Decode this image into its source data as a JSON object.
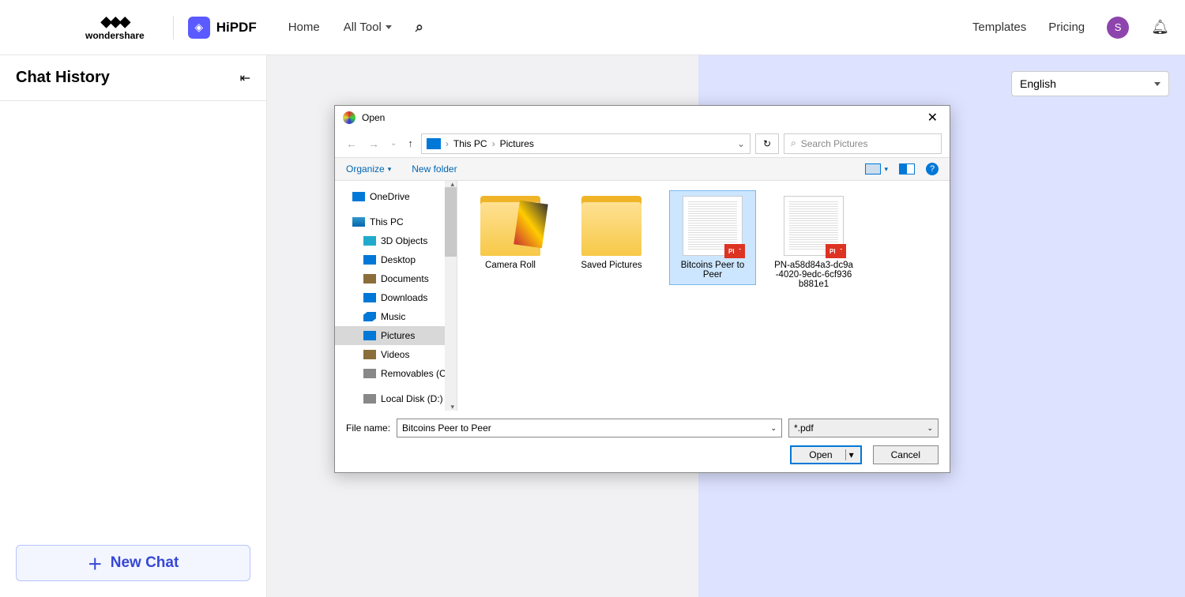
{
  "header": {
    "wondershare": "wondershare",
    "hipdf": "HiPDF",
    "home": "Home",
    "all_tool": "All Tool",
    "templates": "Templates",
    "pricing": "Pricing",
    "avatar_initial": "S"
  },
  "sidebar": {
    "title": "Chat History",
    "new_chat": "New Chat"
  },
  "main": {
    "language": "English"
  },
  "dialog": {
    "title": "Open",
    "breadcrumb": {
      "root": "This PC",
      "folder": "Pictures"
    },
    "search_placeholder": "Search Pictures",
    "organize": "Organize",
    "new_folder": "New folder",
    "tree": {
      "onedrive": "OneDrive",
      "this_pc": "This PC",
      "objects3d": "3D Objects",
      "desktop": "Desktop",
      "documents": "Documents",
      "downloads": "Downloads",
      "music": "Music",
      "pictures": "Pictures",
      "videos": "Videos",
      "removables": "Removables (C:)",
      "local_d": "Local Disk (D:)"
    },
    "files": {
      "camera_roll": "Camera Roll",
      "saved_pictures": "Saved Pictures",
      "bitcoins": "Bitcoins Peer to Peer",
      "pn_file": "PN-a58d84a3-dc9a-4020-9edc-6cf936b881e1",
      "pdf_badge": "PDF"
    },
    "filename_label": "File name:",
    "filename_value": "Bitcoins Peer to Peer",
    "filetype": "*.pdf",
    "open_btn": "Open",
    "cancel_btn": "Cancel"
  }
}
